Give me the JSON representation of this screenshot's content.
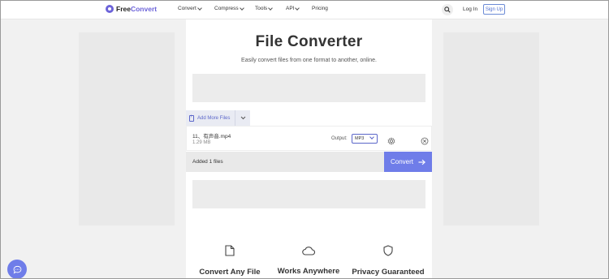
{
  "header": {
    "logo_prefix": "Free",
    "logo_suffix": "Convert",
    "nav": [
      {
        "label": "Convert"
      },
      {
        "label": "Compress"
      },
      {
        "label": "Tools"
      },
      {
        "label": "API"
      },
      {
        "label": "Pricing"
      }
    ],
    "login_label": "Log In",
    "signup_label": "Sign Up"
  },
  "main": {
    "title": "File Converter",
    "subtitle": "Easily convert files from one format to another, online.",
    "add_files_label": "Add More Files",
    "file": {
      "name": "11、有声音.mp4",
      "size": "1.29 MB",
      "output_label": "Output:",
      "format": "MP3"
    },
    "status": "Added 1 files",
    "convert_label": "Convert"
  },
  "features": [
    {
      "label": "Convert Any File",
      "icon": "file-icon"
    },
    {
      "label": "Works Anywhere",
      "icon": "cloud-icon"
    },
    {
      "label": "Privacy Guaranteed",
      "icon": "shield-icon"
    }
  ],
  "colors": {
    "brand": "#6c63d9",
    "button": "#6f7de9",
    "link": "#5b66c9"
  }
}
